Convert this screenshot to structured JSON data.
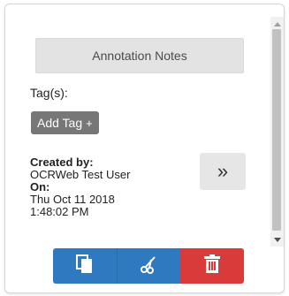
{
  "panel": {
    "notes_button_label": "Annotation Notes",
    "tags_label": "Tag(s):",
    "add_tag_label": "Add Tag",
    "add_tag_plus": "+",
    "created_by_label": "Created by:",
    "created_by_value": "OCRWeb Test User",
    "on_label": "On:",
    "date_line": "Thu Oct 11 2018",
    "time_line": "1:48:02 PM",
    "expand_glyph": "»"
  },
  "actions": {
    "copy_icon": "copy-icon",
    "cut_icon": "scissors-icon",
    "delete_icon": "trash-icon"
  },
  "colors": {
    "primary": "#2f79c0",
    "danger": "#d93b3b",
    "tag_bg": "#777777"
  }
}
